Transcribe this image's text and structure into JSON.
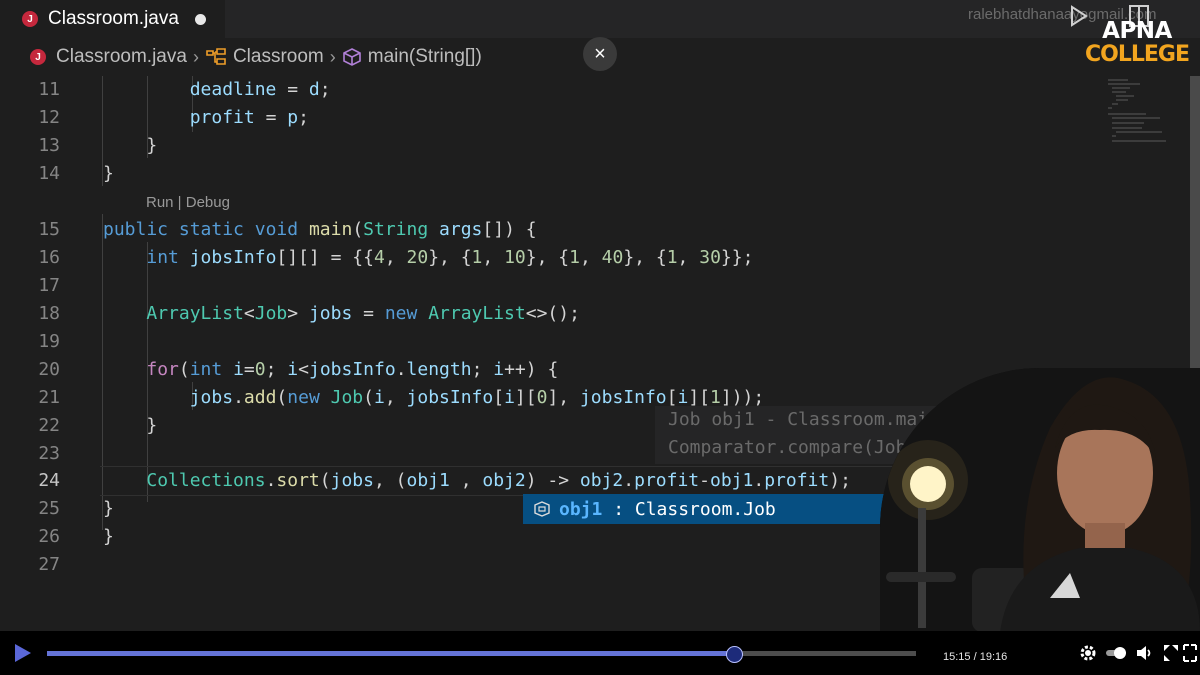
{
  "tab": {
    "icon_letter": "J",
    "label": "Classroom.java",
    "dirty_indicator": "modified-dot"
  },
  "overlay_email": "ralebhatdhanaayogmail.com",
  "breadcrumb": [
    {
      "label": "Classroom.java",
      "icon": "java-file-icon"
    },
    {
      "label": "Classroom",
      "icon": "class-icon"
    },
    {
      "label": "main(String[])",
      "icon": "method-cube-icon"
    }
  ],
  "close_button": {
    "label": "×"
  },
  "logo": {
    "top": "APNA",
    "bottom": "COLLEGE"
  },
  "codelens": "Run | Debug",
  "lines": [
    {
      "n": "11",
      "code": "        deadline = d;"
    },
    {
      "n": "12",
      "code": "        profit = p;"
    },
    {
      "n": "13",
      "code": "    }"
    },
    {
      "n": "14",
      "code": "}"
    },
    {
      "n": "15",
      "code": "public static void main(String args[]) {"
    },
    {
      "n": "16",
      "code": "    int jobsInfo[][] = {{4, 20}, {1, 10}, {1, 40}, {1, 30}};"
    },
    {
      "n": "17",
      "code": ""
    },
    {
      "n": "18",
      "code": "    ArrayList<Job> jobs = new ArrayList<>();"
    },
    {
      "n": "19",
      "code": ""
    },
    {
      "n": "20",
      "code": "    for(int i=0; i<jobsInfo.length; i++) {"
    },
    {
      "n": "21",
      "code": "        jobs.add(new Job(i, jobsInfo[i][0], jobsInfo[i][1]));"
    },
    {
      "n": "22",
      "code": "    }"
    },
    {
      "n": "23",
      "code": ""
    },
    {
      "n": "24",
      "code": "    Collections.sort(jobs, (obj1 , obj2) -> obj2.profit-obj1.profit);"
    },
    {
      "n": "25",
      "code": "}"
    },
    {
      "n": "26",
      "code": "}"
    },
    {
      "n": "27",
      "code": ""
    }
  ],
  "signature_hint": {
    "line1": "Job obj1 - Classroom.main",
    "line2": "Comparator.compare(Job"
  },
  "suggestion": {
    "name": "obj1",
    "detail": " : Classroom.Job",
    "icon": "variable-icon"
  },
  "player": {
    "current_time": "15:15",
    "separator": " / ",
    "total_time": "19:16",
    "progress_percent": 79.1,
    "colors": {
      "fill": "#6473d6",
      "track": "#4d4d4d"
    }
  },
  "colors": {
    "editor_bg": "#1e1e1e",
    "keyword": "#569cd6",
    "type": "#4ec9b0",
    "function": "#dcdcaa",
    "variable": "#9cdcfe",
    "number": "#b5cea8",
    "control": "#c586c0",
    "logo_accent": "#f2a51f"
  }
}
